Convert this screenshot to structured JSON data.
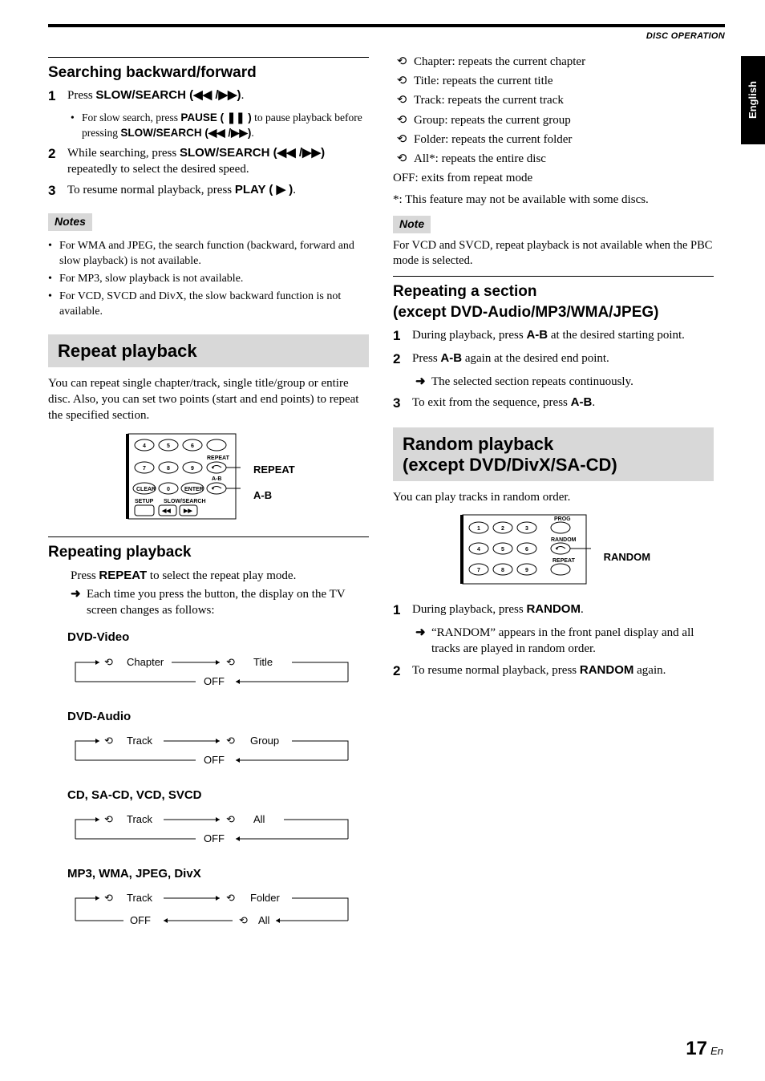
{
  "header": {
    "section": "DISC OPERATION",
    "lang_tab": "English"
  },
  "left": {
    "search": {
      "title": "Searching backward/forward",
      "steps": [
        {
          "n": "1",
          "pre": "Press ",
          "bold": "SLOW/SEARCH (◀◀ /▶▶)",
          "post": ".",
          "sub_pre": "For slow search, press ",
          "sub_bold": "PAUSE ( ❚❚ )",
          "sub_mid": " to pause playback before pressing ",
          "sub_bold2": "SLOW/SEARCH (◀◀ /▶▶)",
          "sub_post": "."
        },
        {
          "n": "2",
          "pre": "While searching, press ",
          "bold": "SLOW/SEARCH (◀◀ /▶▶)",
          "post": " repeatedly to select the desired speed."
        },
        {
          "n": "3",
          "pre": "To resume normal playback, press ",
          "bold": "PLAY ( ▶ )",
          "post": "."
        }
      ],
      "notes_label": "Notes",
      "notes": [
        "For WMA and JPEG, the search function (backward, forward and slow playback) is not available.",
        "For MP3, slow playback is not available.",
        "For VCD, SVCD and DivX, the slow backward function is not available."
      ]
    },
    "repeat_box": {
      "title": "Repeat playback",
      "intro": "You can repeat single chapter/track, single title/group or entire disc. Also, you can set two points (start and end points) to repeat the specified section.",
      "callouts": {
        "repeat": "REPEAT",
        "ab": "A-B"
      }
    },
    "repeating": {
      "title": "Repeating playback",
      "line_pre": "Press ",
      "line_bold": "REPEAT",
      "line_post": " to select the repeat play mode.",
      "arrow_text": "Each time you press the button, the display on the TV screen changes as follows:",
      "formats": [
        {
          "head": "DVD-Video",
          "a": "Chapter",
          "b": "Title",
          "off": "OFF"
        },
        {
          "head": "DVD-Audio",
          "a": "Track",
          "b": "Group",
          "off": "OFF"
        },
        {
          "head": "CD, SA-CD, VCD, SVCD",
          "a": "Track",
          "b": "All",
          "off": "OFF"
        },
        {
          "head": "MP3, WMA, JPEG, DivX",
          "a": "Track",
          "b": "Folder",
          "off": "OFF",
          "c": "All"
        }
      ]
    }
  },
  "right": {
    "repeat_items": [
      "Chapter: repeats the current chapter",
      "Title: repeats the current title",
      "Track: repeats the current track",
      "Group: repeats the current group",
      "Folder: repeats the current folder",
      "All*: repeats the entire disc"
    ],
    "off_line": "OFF: exits from repeat mode",
    "asterisk": "*: This feature may not be available with some discs.",
    "note_label": "Note",
    "note_text": "For VCD and SVCD, repeat playback is not available when the PBC mode is selected.",
    "section_ab": {
      "title1": "Repeating a section",
      "title2": "(except DVD-Audio/MP3/WMA/JPEG)",
      "steps": [
        {
          "n": "1",
          "pre": "During playback, press ",
          "bold": "A-B",
          "post": " at the desired starting point."
        },
        {
          "n": "2",
          "pre": "Press ",
          "bold": "A-B",
          "post": " again at the desired end point.",
          "arrow": "The selected section repeats continuously."
        },
        {
          "n": "3",
          "pre": "To exit from the sequence, press ",
          "bold": "A-B",
          "post": "."
        }
      ]
    },
    "random_box": {
      "title1": "Random playback",
      "title2": "(except DVD/DivX/SA-CD)",
      "intro": "You can play tracks in random order.",
      "callout": "RANDOM",
      "steps": [
        {
          "n": "1",
          "pre": "During playback, press ",
          "bold": "RANDOM",
          "post": ".",
          "arrow": "“RANDOM” appears in the front panel display and all tracks are played in random order."
        },
        {
          "n": "2",
          "pre": "To resume normal playback, press ",
          "bold": "RANDOM",
          "post": " again."
        }
      ],
      "key_labels": {
        "prog": "PROG",
        "random": "RANDOM",
        "repeat": "REPEAT"
      }
    }
  },
  "remote1_labels": {
    "clear": "CLEAR",
    "enter": "ENTER",
    "setup": "SETUP",
    "slow": "SLOW/SEARCH",
    "repeat": "REPEAT",
    "ab": "A-B"
  },
  "page": {
    "num": "17",
    "suffix": "En"
  }
}
